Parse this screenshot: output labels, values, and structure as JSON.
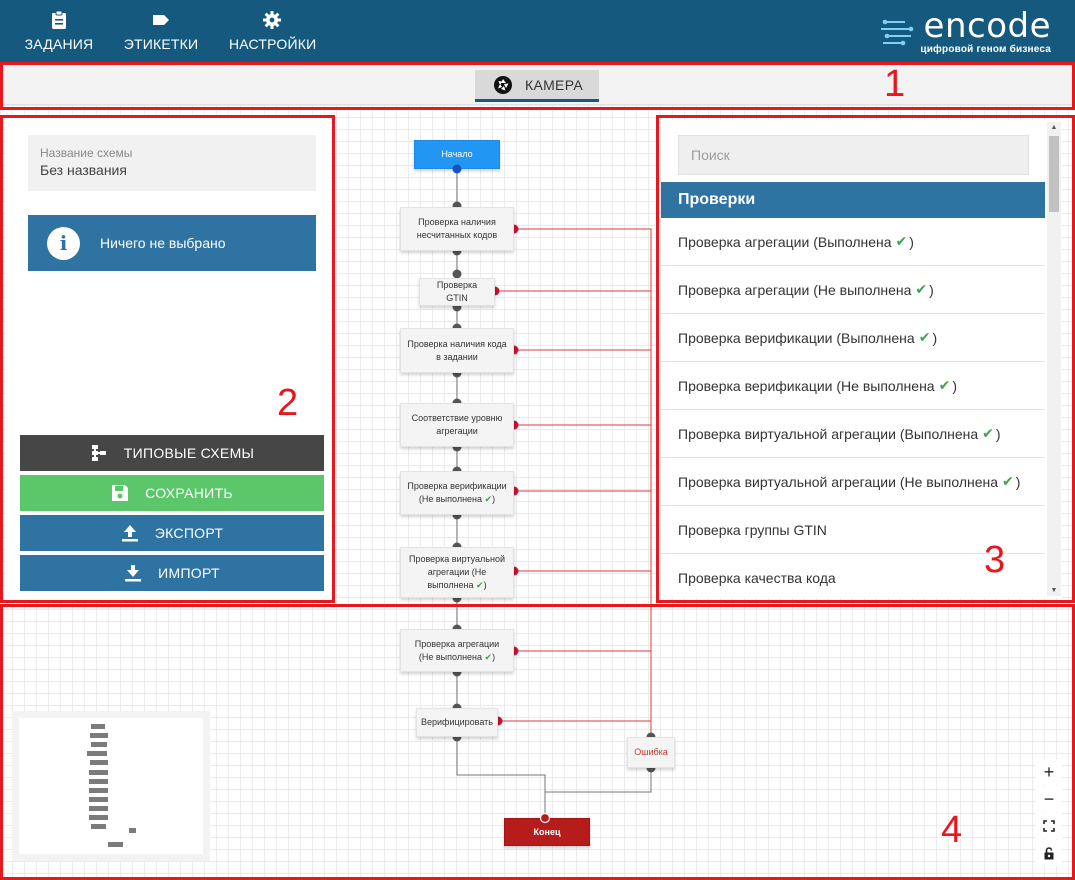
{
  "nav": {
    "items": [
      {
        "label": "ЗАДАНИЯ",
        "icon": "clipboard-icon"
      },
      {
        "label": "ЭТИКЕТКИ",
        "icon": "tag-icon"
      },
      {
        "label": "НАСТРОЙКИ",
        "icon": "gear-icon"
      }
    ]
  },
  "logo": {
    "word": "encode",
    "tagline": "цифровой геном бизнеса"
  },
  "camera_tab": {
    "label": "КАМЕРА",
    "icon": "camera-aperture-icon"
  },
  "left_panel": {
    "scheme_name_label": "Название схемы",
    "scheme_name_value": "Без названия",
    "info_icon": "i",
    "info_text": "Ничего не выбрано",
    "buttons": {
      "templates": "ТИПОВЫЕ СХЕМЫ",
      "save": "СОХРАНИТЬ",
      "export": "ЭКСПОРТ",
      "import": "ИМПОРТ"
    }
  },
  "right_panel": {
    "search_placeholder": "Поиск",
    "section_title": "Проверки",
    "items": [
      {
        "text": "Проверка агрегации (Выполнена",
        "check": "✔",
        "tail": ")"
      },
      {
        "text": "Проверка агрегации (Не выполнена",
        "check": "✔",
        "tail": ")"
      },
      {
        "text": "Проверка верификации (Выполнена",
        "check": "✔",
        "tail": ")"
      },
      {
        "text": "Проверка верификации (Не выполнена",
        "check": "✔",
        "tail": ")"
      },
      {
        "text": "Проверка виртуальной агрегации (Выполнена",
        "check": "✔",
        "tail": ")"
      },
      {
        "text": "Проверка виртуальной агрегации (Не выполнена",
        "check": "✔",
        "tail": ")"
      },
      {
        "text": "Проверка группы GTIN",
        "check": "",
        "tail": ""
      },
      {
        "text": "Проверка качества кода",
        "check": "",
        "tail": ""
      }
    ]
  },
  "flow": {
    "start": "Начало",
    "n1": "Проверка наличия несчитанных кодов",
    "n2": "Проверка GTIN",
    "n3": "Проверка наличия кода в задании",
    "n4": "Соответствие уровню агрегации",
    "n5": "Проверка верификации (Не выполнена",
    "n6": "Проверка виртуальной агрегации (Не выполнена",
    "n7": "Проверка агрегации (Не выполнена",
    "n7_check": "✔",
    "n8": "Верифицировать",
    "error": "Ошибка",
    "end": "Конец"
  },
  "zoom": {
    "in": "+",
    "out": "−",
    "fit": "fit-screen-icon",
    "lock": "lock-icon"
  },
  "annotations": [
    "1",
    "2",
    "3",
    "4"
  ],
  "colors": {
    "header": "#16597f",
    "primary": "#2e73a1",
    "save": "#5bc66a",
    "dark_button": "#464646",
    "start_node": "#2196f3",
    "end_node": "#b71c1c",
    "error_wire": "#e0393e",
    "check": "#3fa34d",
    "annotation": "#e8161d"
  }
}
